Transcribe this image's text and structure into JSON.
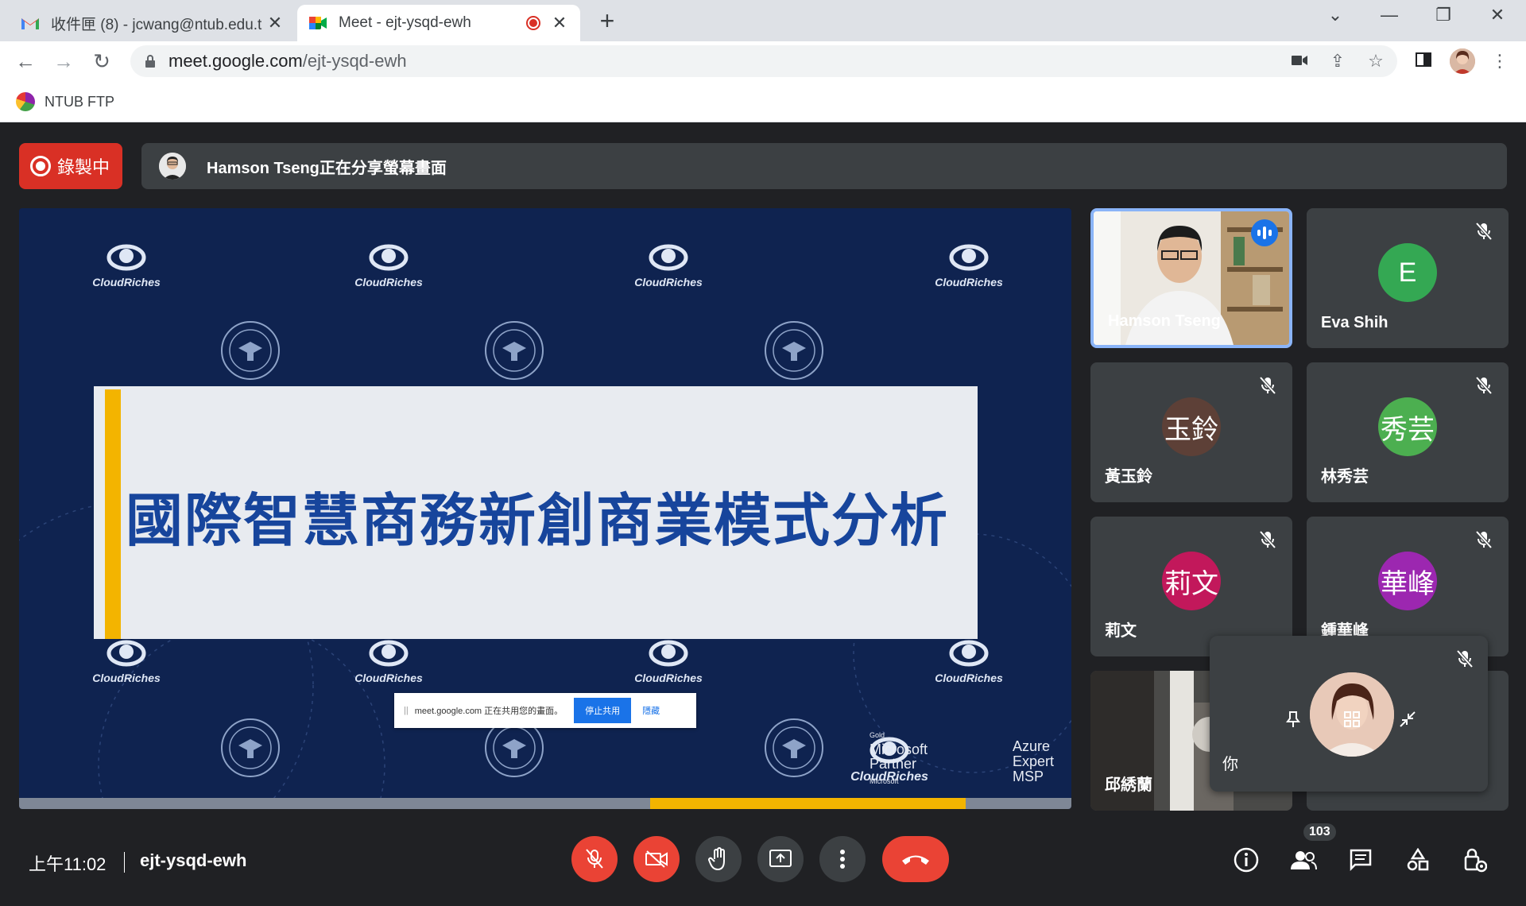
{
  "browser": {
    "tabs": [
      {
        "title": "收件匣 (8) - jcwang@ntub.edu.t",
        "active": false
      },
      {
        "title": "Meet - ejt-ysqd-ewh",
        "active": true
      }
    ],
    "url_host": "meet.google.com",
    "url_path": "/ejt-ysqd-ewh",
    "bookmark": "NTUB FTP"
  },
  "meet": {
    "recording_label": "錄製中",
    "presenter_banner": "Hamson Tseng正在分享螢幕畫面",
    "slide": {
      "title": "國際智慧商務新創商業模式分析",
      "logo_text": "CloudRiches",
      "share_popup": {
        "message": "meet.google.com 正在共用您的畫面。",
        "stop_label": "停止共用",
        "hide_label": "隱藏"
      },
      "ms_gold": "Gold",
      "ms_line1": "Microsoft",
      "ms_line2": "Partner",
      "ms_small": "Microsoft",
      "azure_line1": "Azure",
      "azure_line2": "Expert",
      "azure_line3": "MSP",
      "progress_fraction": 0.3
    },
    "participants": [
      {
        "name": "Hamson Tseng",
        "speaking": true
      },
      {
        "name": "Eva Shih",
        "initials": "E",
        "color": "#34a853",
        "muted": true
      },
      {
        "name": "黃玉鈴",
        "initials": "玉鈴",
        "color": "#5d4037",
        "muted": true
      },
      {
        "name": "林秀芸",
        "initials": "秀芸",
        "color": "#4caf50",
        "muted": true
      },
      {
        "name": "莉文",
        "initials": "莉文",
        "color": "#c2185b",
        "muted": true
      },
      {
        "name": "鍾華峰",
        "initials": "華峰",
        "color": "#9c27b0",
        "muted": true
      },
      {
        "name": "邱綉蘭"
      }
    ],
    "self_view": {
      "name": "你",
      "muted": true
    },
    "bottom": {
      "time": "上午11:02",
      "meeting_code": "ejt-ysqd-ewh",
      "people_count": "103"
    }
  },
  "colors": {
    "accent": "#1a73e8",
    "danger": "#ea4335",
    "slide_bg": "#0f2350",
    "slide_title": "#17459c",
    "highlight": "#f3b400"
  }
}
